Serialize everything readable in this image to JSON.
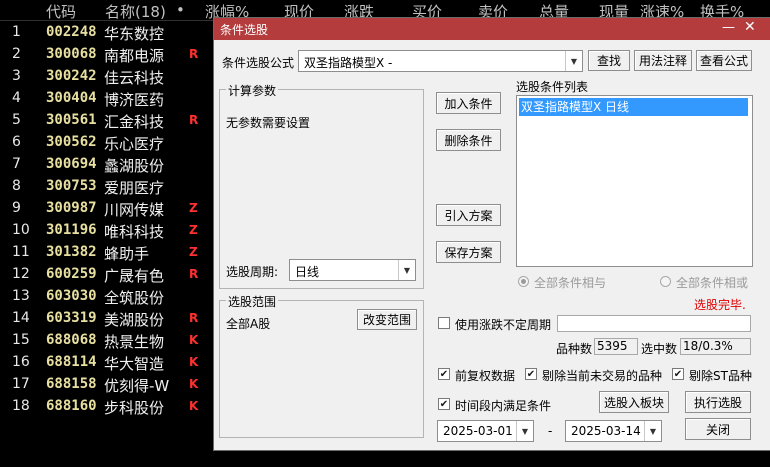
{
  "list": {
    "headers": [
      "代码",
      "名称(18)",
      "•",
      "涨幅%",
      "现价",
      "涨跌",
      "买价",
      "卖价",
      "总量",
      "现量",
      "涨速%",
      "换手%"
    ],
    "rows": [
      {
        "idx": "1",
        "code": "002248",
        "name": "华东数控",
        "flag": ""
      },
      {
        "idx": "2",
        "code": "300068",
        "name": "南都电源",
        "flag": "R"
      },
      {
        "idx": "3",
        "code": "300242",
        "name": "佳云科技",
        "flag": ""
      },
      {
        "idx": "4",
        "code": "300404",
        "name": "博济医药",
        "flag": ""
      },
      {
        "idx": "5",
        "code": "300561",
        "name": "汇金科技",
        "flag": "R"
      },
      {
        "idx": "6",
        "code": "300562",
        "name": "乐心医疗",
        "flag": ""
      },
      {
        "idx": "7",
        "code": "300694",
        "name": "蠡湖股份",
        "flag": ""
      },
      {
        "idx": "8",
        "code": "300753",
        "name": "爱朋医疗",
        "flag": ""
      },
      {
        "idx": "9",
        "code": "300987",
        "name": "川网传媒",
        "flag": "Z"
      },
      {
        "idx": "10",
        "code": "301196",
        "name": "唯科科技",
        "flag": "Z"
      },
      {
        "idx": "11",
        "code": "301382",
        "name": "蜂助手",
        "flag": "Z"
      },
      {
        "idx": "12",
        "code": "600259",
        "name": "广晟有色",
        "flag": "R"
      },
      {
        "idx": "13",
        "code": "603030",
        "name": "全筑股份",
        "flag": ""
      },
      {
        "idx": "14",
        "code": "603319",
        "name": "美湖股份",
        "flag": "R"
      },
      {
        "idx": "15",
        "code": "688068",
        "name": "热景生物",
        "flag": "K"
      },
      {
        "idx": "16",
        "code": "688114",
        "name": "华大智造",
        "flag": "K"
      },
      {
        "idx": "17",
        "code": "688158",
        "name": "优刻得-W",
        "flag": "K"
      },
      {
        "idx": "18",
        "code": "688160",
        "name": "步科股份",
        "flag": "K"
      }
    ]
  },
  "dialog": {
    "title": "条件选股",
    "formula_label": "条件选股公式",
    "formula_value": "双圣指路模型X -",
    "find_button": "查找",
    "usage_button": "用法注释",
    "view_formula_button": "查看公式",
    "params_group": "计算参数",
    "params_text": "无参数需要设置",
    "period_label": "选股周期:",
    "period_value": "日线",
    "add_condition": "加入条件",
    "delete_condition": "删除条件",
    "import_plan": "引入方案",
    "save_plan": "保存方案",
    "conditions_list_label": "选股条件列表",
    "conditions": [
      "双圣指路模型X  日线"
    ],
    "radio_and": "全部条件相与",
    "radio_or": "全部条件相或",
    "status_text": "选股完毕.",
    "range_group": "选股范围",
    "range_value": "全部A股",
    "change_range": "改变范围",
    "use_limit_period": "使用涨跌不定周期",
    "count_label": "品种数",
    "count_value": "5395",
    "selected_label": "选中数",
    "selected_value": "18/0.3%",
    "opt_prior_adjust": "前复权数据",
    "opt_remove_untraded": "剔除当前未交易的品种",
    "opt_remove_st": "剔除ST品种",
    "opt_period_satisfy": "时间段内满足条件",
    "to_block_button": "选股入板块",
    "execute_button": "执行选股",
    "date_from": "2025-03-01",
    "date_sep": "-",
    "date_to": "2025-03-14",
    "close_button": "关闭",
    "colors": {
      "title_bg": "#b43c3c",
      "status": "#e00000",
      "selected_item": "#3399ff"
    }
  }
}
